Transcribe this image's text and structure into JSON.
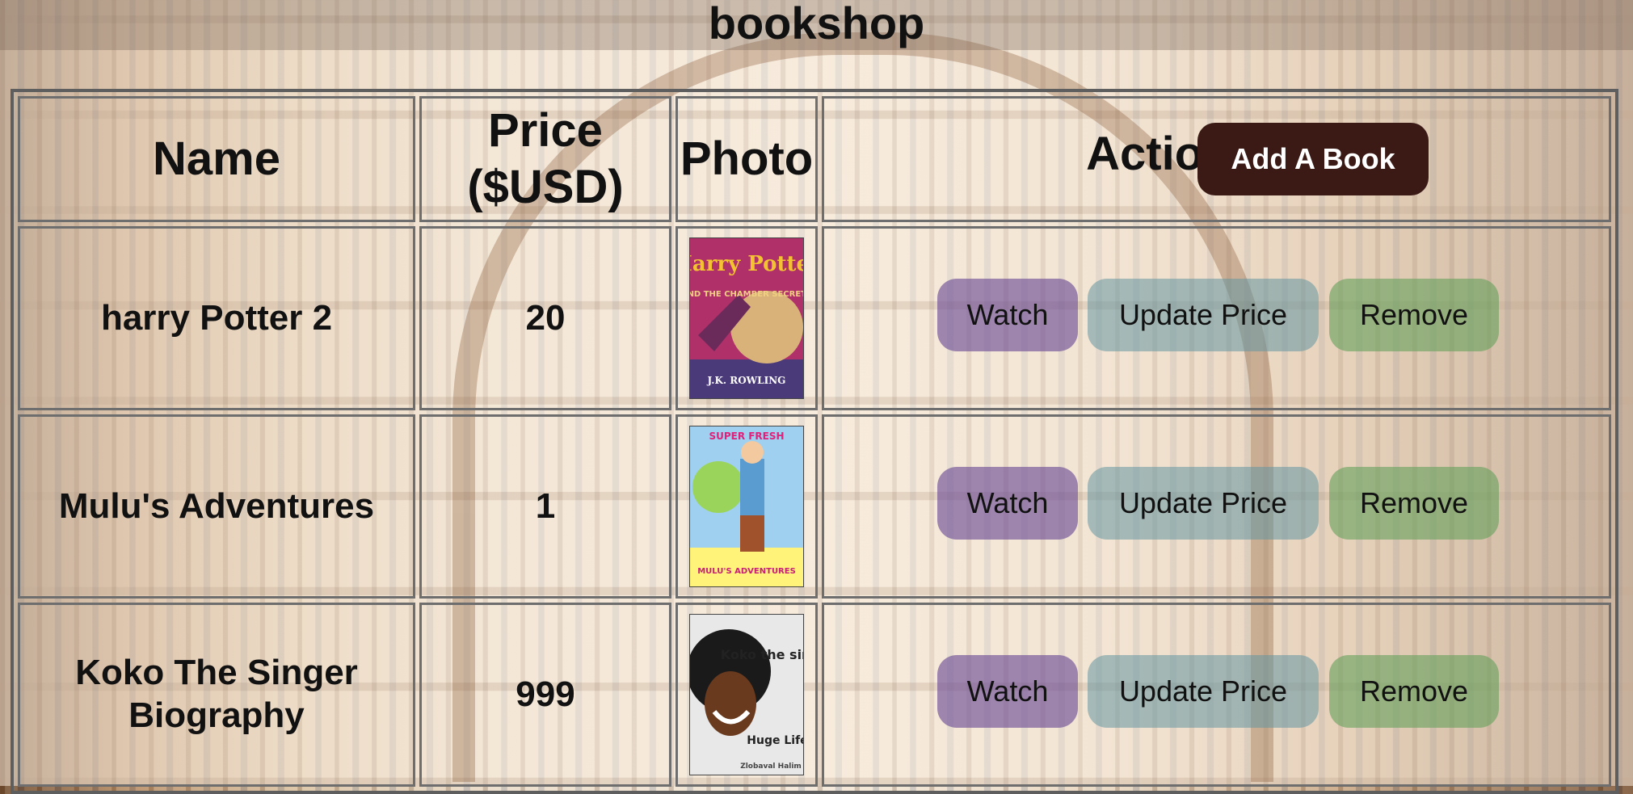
{
  "app": {
    "title": "bookshop"
  },
  "table": {
    "headers": {
      "name": "Name",
      "price": "Price ($USD)",
      "photo": "Photo",
      "actions": "Actions"
    },
    "add_button": "Add A Book",
    "rows": [
      {
        "name": "harry Potter 2",
        "price": "20",
        "cover_text": {
          "top": "Harry Potter",
          "mid": "AND THE CHAMBER SECRETS",
          "bottom": "J.K. ROWLING"
        }
      },
      {
        "name": "Mulu's Adventures",
        "price": "1",
        "cover_text": {
          "top": "SUPER FRESH",
          "bottom": "MULU'S ADVENTURES"
        }
      },
      {
        "name": "Koko The Singer Biography",
        "price": "999",
        "cover_text": {
          "top": "Koko the singer-",
          "bottom": "Huge Life",
          "author": "Zlobaval Halim"
        }
      }
    ],
    "row_actions": {
      "watch": "Watch",
      "update": "Update Price",
      "remove": "Remove"
    }
  }
}
